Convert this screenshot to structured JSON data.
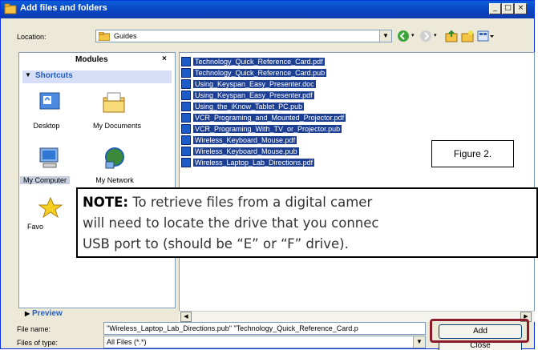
{
  "window": {
    "title": "Add files and folders",
    "buttons": {
      "minimize": "_",
      "maximize": "□",
      "close": "×"
    }
  },
  "location": {
    "label": "Location:",
    "value": "Guides"
  },
  "toolbar": {
    "icons": [
      "back-icon",
      "forward-icon",
      "up-folder-icon",
      "new-folder-icon",
      "views-icon"
    ]
  },
  "left_pane": {
    "header": "Modules",
    "close": "×",
    "section": "Shortcuts",
    "shortcuts": [
      {
        "label": "Desktop",
        "icon": "desktop-icon"
      },
      {
        "label": "My Documents",
        "icon": "my-documents-icon"
      },
      {
        "label": "My Computer",
        "icon": "my-computer-icon"
      },
      {
        "label": "My Network",
        "icon": "my-network-icon"
      }
    ],
    "partial_label": "Favo",
    "preview": "Preview"
  },
  "files": [
    "Technology_Quick_Reference_Card.pdf",
    "Technology_Quick_Reference_Card.pub",
    "Using_Keyspan_Easy_Presenter.doc",
    "Using_Keyspan_Easy_Presenter.pdf",
    "Using_the_iKnow_Tablet_PC.pub",
    "VCR_Programing_and_Mounted_Projector.pdf",
    "VCR_Programing_With_TV_or_Projector.pub",
    "Wireless_Keyboard_Mouse.pdf",
    "Wireless_Keyboard_Mouse.pub",
    "Wireless_Laptop_Lab_Directions.pdf"
  ],
  "figure_label": "Figure 2.",
  "note": {
    "bold": "NOTE:",
    "line1": " To retrieve files from a digital camer",
    "line2": "will need to locate the drive that you connec",
    "line3": "USB port to (should be “E” or “F” drive)."
  },
  "file_name": {
    "label": "File name:",
    "value": "\"Wireless_Laptop_Lab_Directions.pub\" \"Technology_Quick_Reference_Card.p"
  },
  "file_type": {
    "label": "Files of type:",
    "value": "All Files (*.*)"
  },
  "actions": {
    "add": "Add",
    "close": "Close"
  },
  "colors": {
    "selection": "#1c3f94",
    "highlight_box": "#8b1a2b",
    "title_bar": "#0a46c3"
  }
}
